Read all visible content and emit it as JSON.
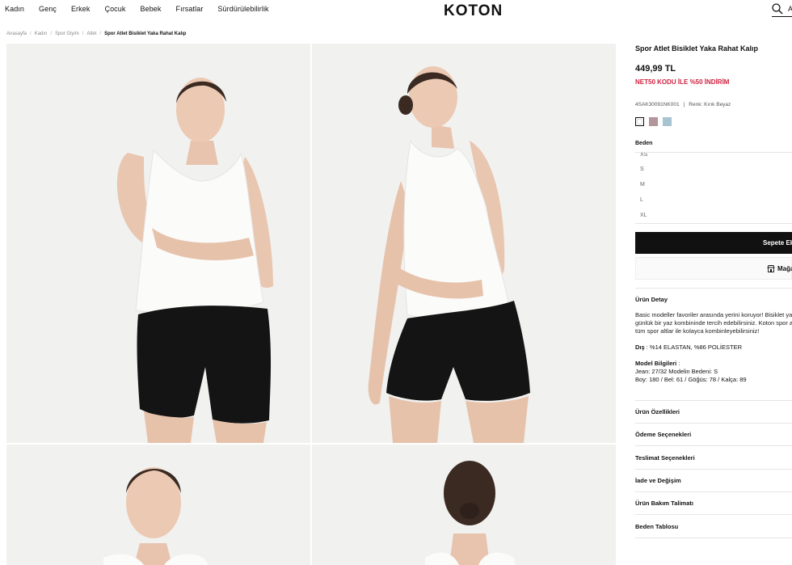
{
  "nav": {
    "items": [
      "Kadın",
      "Genç",
      "Erkek",
      "Çocuk",
      "Bebek",
      "Fırsatlar",
      "Sürdürülebilirlik"
    ],
    "logo": "KOTON",
    "account_letter": "A"
  },
  "breadcrumb": {
    "items": [
      "Anasayfa",
      "Kadın",
      "Spor Giyim",
      "Atlet"
    ],
    "current": "Spor Atlet Bisiklet Yaka Rahat Kalıp"
  },
  "product": {
    "title": "Spor Atlet Bisiklet Yaka Rahat Kalıp",
    "price": "449,99 TL",
    "promo": "NET50 KODU İLE %50 İNDİRİM",
    "sku": "4SAK30091NK001",
    "color_text": "Renk: Kırık Beyaz",
    "colors": [
      "#ffffff",
      "#b3959c",
      "#a8c4d2"
    ],
    "size_label": "Beden",
    "sizes": [
      "XS",
      "S",
      "M",
      "L",
      "XL"
    ],
    "add_to_cart": "Sepete Ekle",
    "store_button": "Mağaz"
  },
  "details": {
    "title": "Ürün Detay",
    "desc_lines": [
      "Basic modeller favoriler arasında yerini koruyor! Bisiklet ya",
      "günlük bir yaz kombininde tercih edebilirsiniz. Koton spor a",
      "tüm spor altlar ile kolayca kombinleyebilirsiniz!"
    ],
    "material_label": "Dış",
    "material_value": ": %14 ELASTAN, %86 POLİESTER",
    "model_label": "Model Bilgileri",
    "model_colon": " :",
    "model_lines": [
      "Jean: 27/32 Modelin Bedeni: S",
      "Boy: 180 / Bel: 61 / Göğüs: 78 / Kalça: 89"
    ]
  },
  "accordion": [
    "Ürün Özellikleri",
    "Ödeme Seçenekleri",
    "Teslimat Seçenekleri",
    "İade ve Değişim",
    "Ürün Bakım Talimatı",
    "Beden Tablosu"
  ]
}
